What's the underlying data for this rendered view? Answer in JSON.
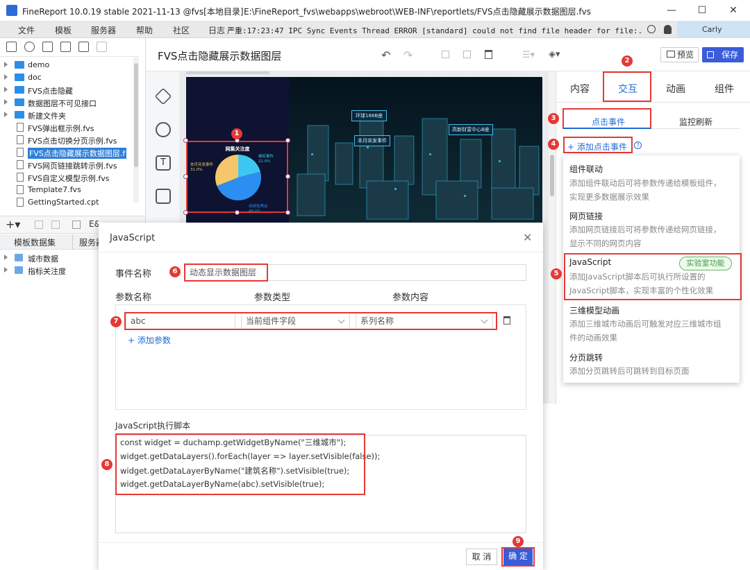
{
  "titlebar": {
    "title": "FineReport 10.0.19 stable 2021-11-13 @fvs[本地目录]",
    "path": "E:\\FineReport_fvs\\webapps\\webroot\\WEB-INF\\reportlets/FVS点击隐藏展示数据图层.fvs"
  },
  "menubar": {
    "items": [
      "文件",
      "模板",
      "服务器",
      "帮助",
      "社区"
    ],
    "log_label": "日志",
    "log_text": "严重:17:23:47 IPC Sync Events Thread ERROR [standard] could not find file header for file:...",
    "user": "Carly"
  },
  "tree": {
    "items": [
      {
        "label": "demo",
        "type": "folder"
      },
      {
        "label": "doc",
        "type": "folder"
      },
      {
        "label": "FVS点击隐藏",
        "type": "folder"
      },
      {
        "label": "数据图层不可见接口",
        "type": "folder"
      },
      {
        "label": "新建文件夹",
        "type": "folder"
      },
      {
        "label": "FVS弹出框示例.fvs",
        "type": "file"
      },
      {
        "label": "FVS点击切换分页示例.fvs",
        "type": "file"
      },
      {
        "label": "FVS点击隐藏展示数据图层.f",
        "type": "file",
        "selected": true
      },
      {
        "label": "FVS网页链接跳转示例.fvs",
        "type": "file"
      },
      {
        "label": "FVS自定义模型示例.fvs",
        "type": "file"
      },
      {
        "label": "Template7.fvs",
        "type": "file"
      },
      {
        "label": "GettingStarted.cpt",
        "type": "file"
      }
    ]
  },
  "datasets": {
    "tab_template": "模板数据集",
    "tab_server": "服务器",
    "items": [
      "城市数据",
      "指标关注度"
    ]
  },
  "editor": {
    "title": "FVS点击隐藏展示数据图层",
    "preview": "预览",
    "save": "保存"
  },
  "chart": {
    "title": "网集关注度",
    "slices": [
      {
        "label": "本月突发事件",
        "pct": "31.0%",
        "value": 31.0,
        "color": "#f5c76a"
      },
      {
        "label": "维权事件",
        "pct": "21.0%",
        "value": 21.0,
        "color": "#3cc8f0"
      },
      {
        "label": "持续性舆论",
        "pct": "48.0%",
        "value": 48.0,
        "color": "#2c8ef0"
      }
    ]
  },
  "scene_labels": [
    "环球188B座",
    "本月突发事件",
    "高新财富中心B座"
  ],
  "rightpanel": {
    "tabs": [
      "内容",
      "交互",
      "动画",
      "组件"
    ],
    "subtabs": [
      "点击事件",
      "监控刷新"
    ],
    "add_event": "+ 添加点击事件",
    "menu": [
      {
        "title": "组件联动",
        "desc": "添加组件联动后可将参数传递给模板组件，实现更多数据展示效果"
      },
      {
        "title": "网页链接",
        "desc": "添加网页链接后可将参数传递给网页链接，显示不同的网页内容"
      },
      {
        "title": "JavaScript",
        "desc": "添加JavaScript脚本后可执行所设置的JavaScript脚本，实现丰富的个性化效果",
        "badge": "实验室功能"
      },
      {
        "title": "三维模型动画",
        "desc": "添加三维城市动画后可触发对应三维城市组件的动画效果"
      },
      {
        "title": "分页跳转",
        "desc": "添加分页跳转后可跳转到目标页面"
      }
    ]
  },
  "dialog": {
    "title": "JavaScript",
    "event_name_label": "事件名称",
    "event_name_value": "动态显示数据图层",
    "col_param_name": "参数名称",
    "col_param_type": "参数类型",
    "col_param_content": "参数内容",
    "param": {
      "name": "abc",
      "type": "当前组件字段",
      "content": "系列名称"
    },
    "add_param": "+ 添加参数",
    "script_label": "JavaScript执行脚本",
    "script_lines": [
      "const widget = duchamp.getWidgetByName(\"三维城市\");",
      "widget.getDataLayers().forEach(layer => layer.setVisible(false));",
      "widget.getDataLayerByName(\"建筑名称\").setVisible(true);",
      "widget.getDataLayerByName(abc).setVisible(true);"
    ],
    "cancel": "取 消",
    "ok": "确 定"
  },
  "markers": [
    "1",
    "2",
    "3",
    "4",
    "5",
    "6",
    "7",
    "8",
    "9"
  ]
}
